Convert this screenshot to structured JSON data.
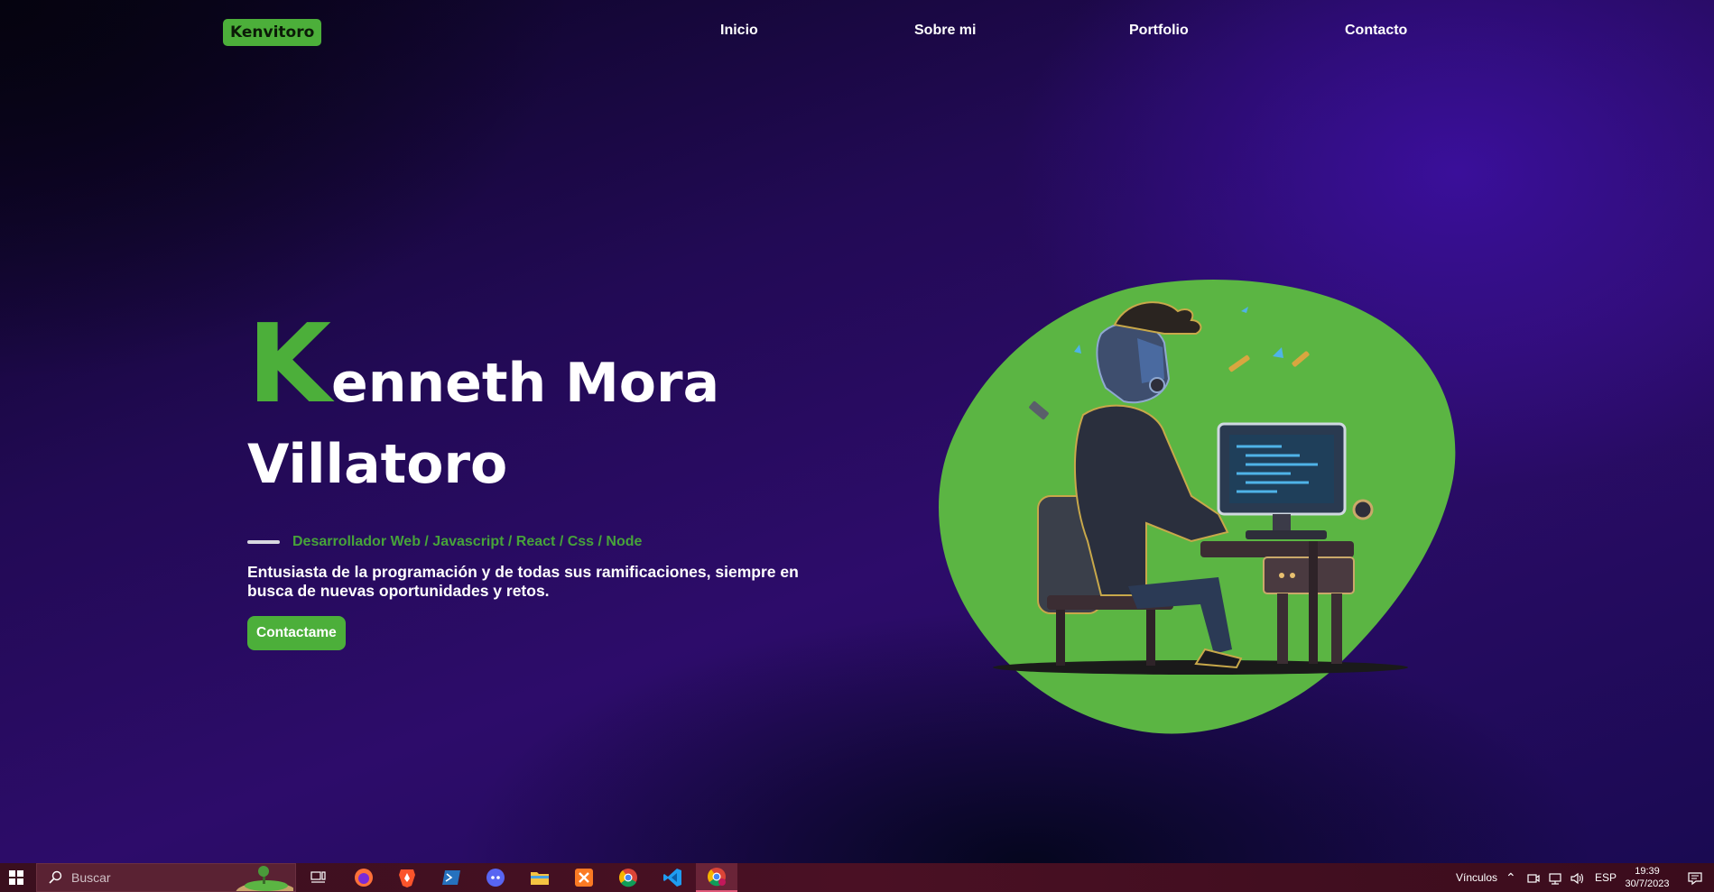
{
  "nav": {
    "logo": "Kenvitoro",
    "links": [
      "Inicio",
      "Sobre mi",
      "Portfolio",
      "Contacto"
    ]
  },
  "hero": {
    "name_initial": "K",
    "name_line1_rest": "enneth Mora",
    "name_line2": "Villatoro",
    "tagline": "Desarrollador Web / Javascript / React / Css / Node",
    "description": "Entusiasta de la programación y de todas sus ramificaciones, siempre en busca de nuevas oportunidades y retos.",
    "cta_label": "Contactame"
  },
  "colors": {
    "accent": "#4caf3a",
    "background": "#220a55",
    "taskbar": "#4a1024"
  },
  "taskbar": {
    "search_placeholder": "Buscar",
    "apps": [
      "task-view-icon",
      "firefox-icon",
      "brave-icon",
      "powershell-icon",
      "discord-icon",
      "file-explorer-icon",
      "xampp-icon",
      "chrome-icon",
      "vscode-icon",
      "chrome-profile-icon"
    ],
    "tray_links": "Vínculos",
    "language": "ESP",
    "time": "19:39",
    "date": "30/7/2023"
  }
}
